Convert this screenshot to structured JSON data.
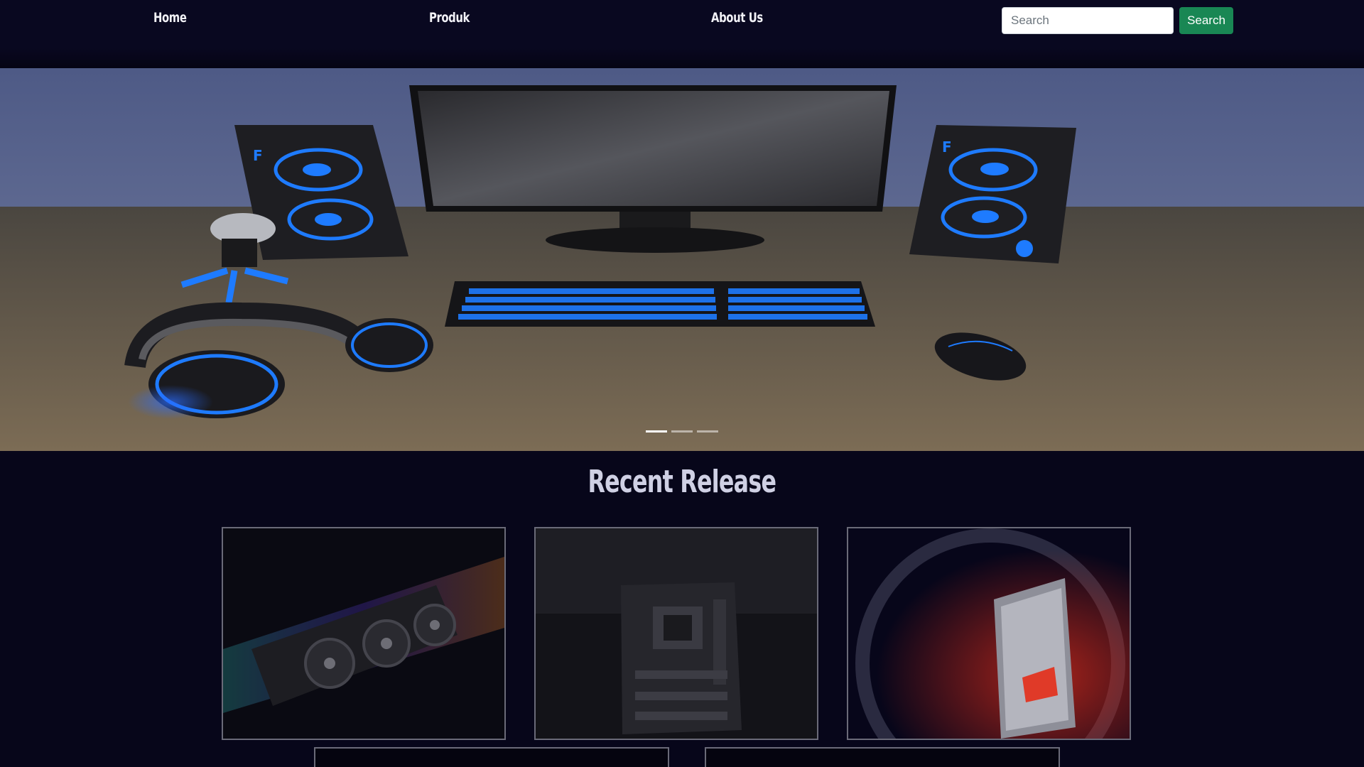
{
  "nav": {
    "links": [
      {
        "label": "Home"
      },
      {
        "label": "Produk"
      },
      {
        "label": "About Us"
      }
    ],
    "search": {
      "placeholder": "Search",
      "button_label": "Search"
    }
  },
  "hero": {
    "slide_count": 3,
    "active_slide": 1,
    "image_icon": "gaming-desk-setup"
  },
  "section": {
    "title": "Recent Release"
  },
  "products": [
    {
      "icon": "graphics-card"
    },
    {
      "icon": "motherboard"
    },
    {
      "icon": "gaming-pc-case"
    },
    {
      "icon": "product-image"
    },
    {
      "icon": "product-image"
    }
  ],
  "colors": {
    "background": "#07061a",
    "navbar": "#090820",
    "accent_green": "#198754",
    "neon_blue": "#1e7bff"
  }
}
